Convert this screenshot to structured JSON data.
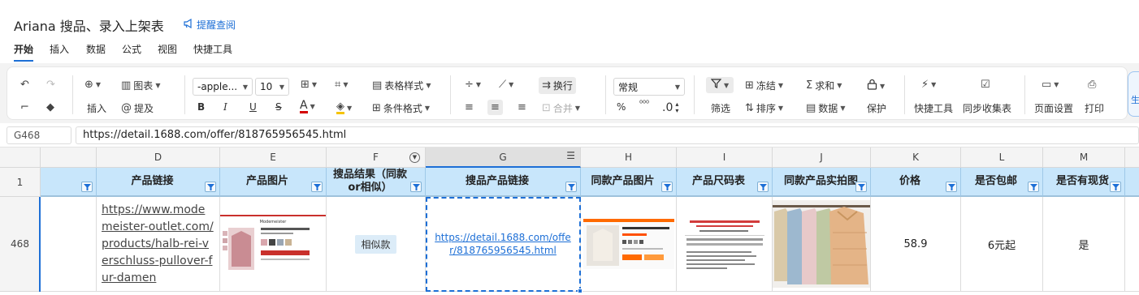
{
  "document": {
    "title": "Ariana 搜品、录入上架表",
    "remind_label": "提醒查阅"
  },
  "menu": {
    "items": [
      "开始",
      "插入",
      "数据",
      "公式",
      "视图",
      "快捷工具"
    ],
    "active": "开始"
  },
  "toolbar": {
    "undo": "undo-icon",
    "redo": "redo-icon",
    "format_painter": "format-painter-icon",
    "clear_format": "eraser-icon",
    "insert_label": "插入",
    "chart_label": "图表",
    "mention_label": "提及",
    "font_family": "-apple...",
    "font_size": "10",
    "bold": "B",
    "italic": "I",
    "underline": "U",
    "strikethrough": "S",
    "text_color_glyph": "A",
    "table_style_label": "表格样式",
    "conditional_format_label": "条件格式",
    "wrap_label": "换行",
    "merge_label": "合并",
    "number_format": "常规",
    "percent_glyph": "%",
    "thousands_glyph": "⁰⁰⁰",
    "decimal_glyph": ".0",
    "filter_label": "筛选",
    "freeze_label": "冻结",
    "sort_label": "排序",
    "sum_label": "求和",
    "data_label": "数据",
    "protect_label": "保护",
    "quick_tools_label": "快捷工具",
    "sync_label": "同步收集表",
    "page_setup_label": "页面设置",
    "print_label": "打印",
    "corner_label": "生"
  },
  "formula_bar": {
    "cell_ref": "G468",
    "content": "https://detail.1688.com/offer/818765956545.html"
  },
  "sheet": {
    "columns": [
      {
        "letter": "",
        "header": ""
      },
      {
        "letter": "D",
        "header": "产品链接"
      },
      {
        "letter": "E",
        "header": "产品图片"
      },
      {
        "letter": "F",
        "header": "搜品结果（同款or相似）"
      },
      {
        "letter": "G",
        "header": "搜品产品链接"
      },
      {
        "letter": "H",
        "header": "同款产品图片"
      },
      {
        "letter": "I",
        "header": "产品尺码表"
      },
      {
        "letter": "J",
        "header": "同款产品实拍图"
      },
      {
        "letter": "K",
        "header": "价格"
      },
      {
        "letter": "L",
        "header": "是否包邮"
      },
      {
        "letter": "M",
        "header": "是否有现货"
      }
    ],
    "header_row_number": "1",
    "row": {
      "number": "468",
      "product_link": "https://www.modemeister-outlet.com/products/halb-rei-verschluss-pullover-fur-damen",
      "search_result": "相似款",
      "search_link": "https://detail.1688.com/offer/818765956545.html",
      "price": "58.9",
      "free_shipping": "6元起",
      "in_stock": "是"
    },
    "selected_cell": "G468",
    "header_fill": "#c8e6fb",
    "accent": "#1d6fd6"
  }
}
